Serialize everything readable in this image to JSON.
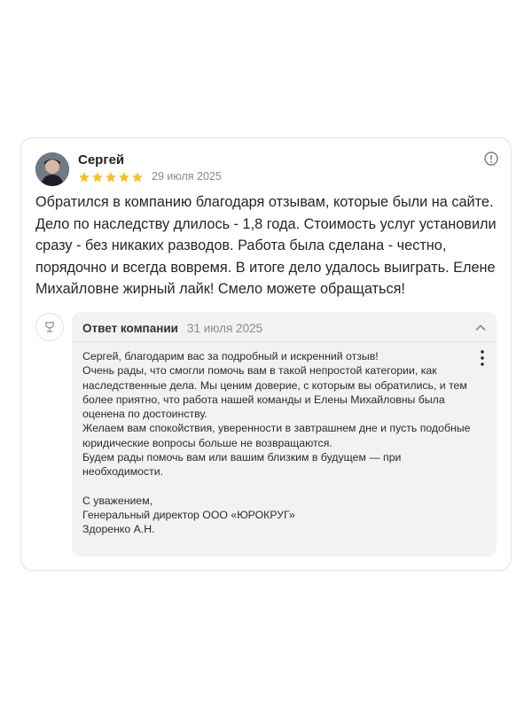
{
  "review": {
    "author": "Сергей",
    "date": "29 июля 2025",
    "rating": 5,
    "text": "Обратился в компанию благодаря отзывам, которые были на сайте. Дело по наследству длилось - 1,8 года. Стоимость услуг установили сразу - без никаких разводов. Работа была сделана - честно, порядочно и всегда вовремя. В итоге дело удалось выиграть. Елене Михайловне жирный лайк! Смело можете обращаться!"
  },
  "reply": {
    "title": "Ответ компании",
    "date": "31 июля 2025",
    "lines": [
      "Сергей, благодарим вас за подробный и искренний отзыв!",
      "Очень рады, что смогли помочь вам в такой непростой категории, как наследственные дела. Мы ценим доверие, с которым вы обратились, и тем более приятно, что работа нашей команды и Елены Михайловны была оценена по достоинству.",
      "Желаем вам спокойствия, уверенности в завтрашнем дне и пусть подобные юридические вопросы больше не возвращаются.",
      "Будем рады помочь вам или вашим близким в будущем — при необходимости."
    ],
    "signature": [
      "С уважением,",
      "Генеральный директор ООО «ЮРОКРУГ»",
      "Здоренко А.Н."
    ]
  },
  "colors": {
    "star": "#fbbf24",
    "reply_bg": "#f2f2f2",
    "muted_text": "#8a8a8a"
  },
  "icons": [
    "info-icon",
    "chevron-up-icon",
    "more-vertical-icon",
    "star-icon",
    "company-logo"
  ]
}
